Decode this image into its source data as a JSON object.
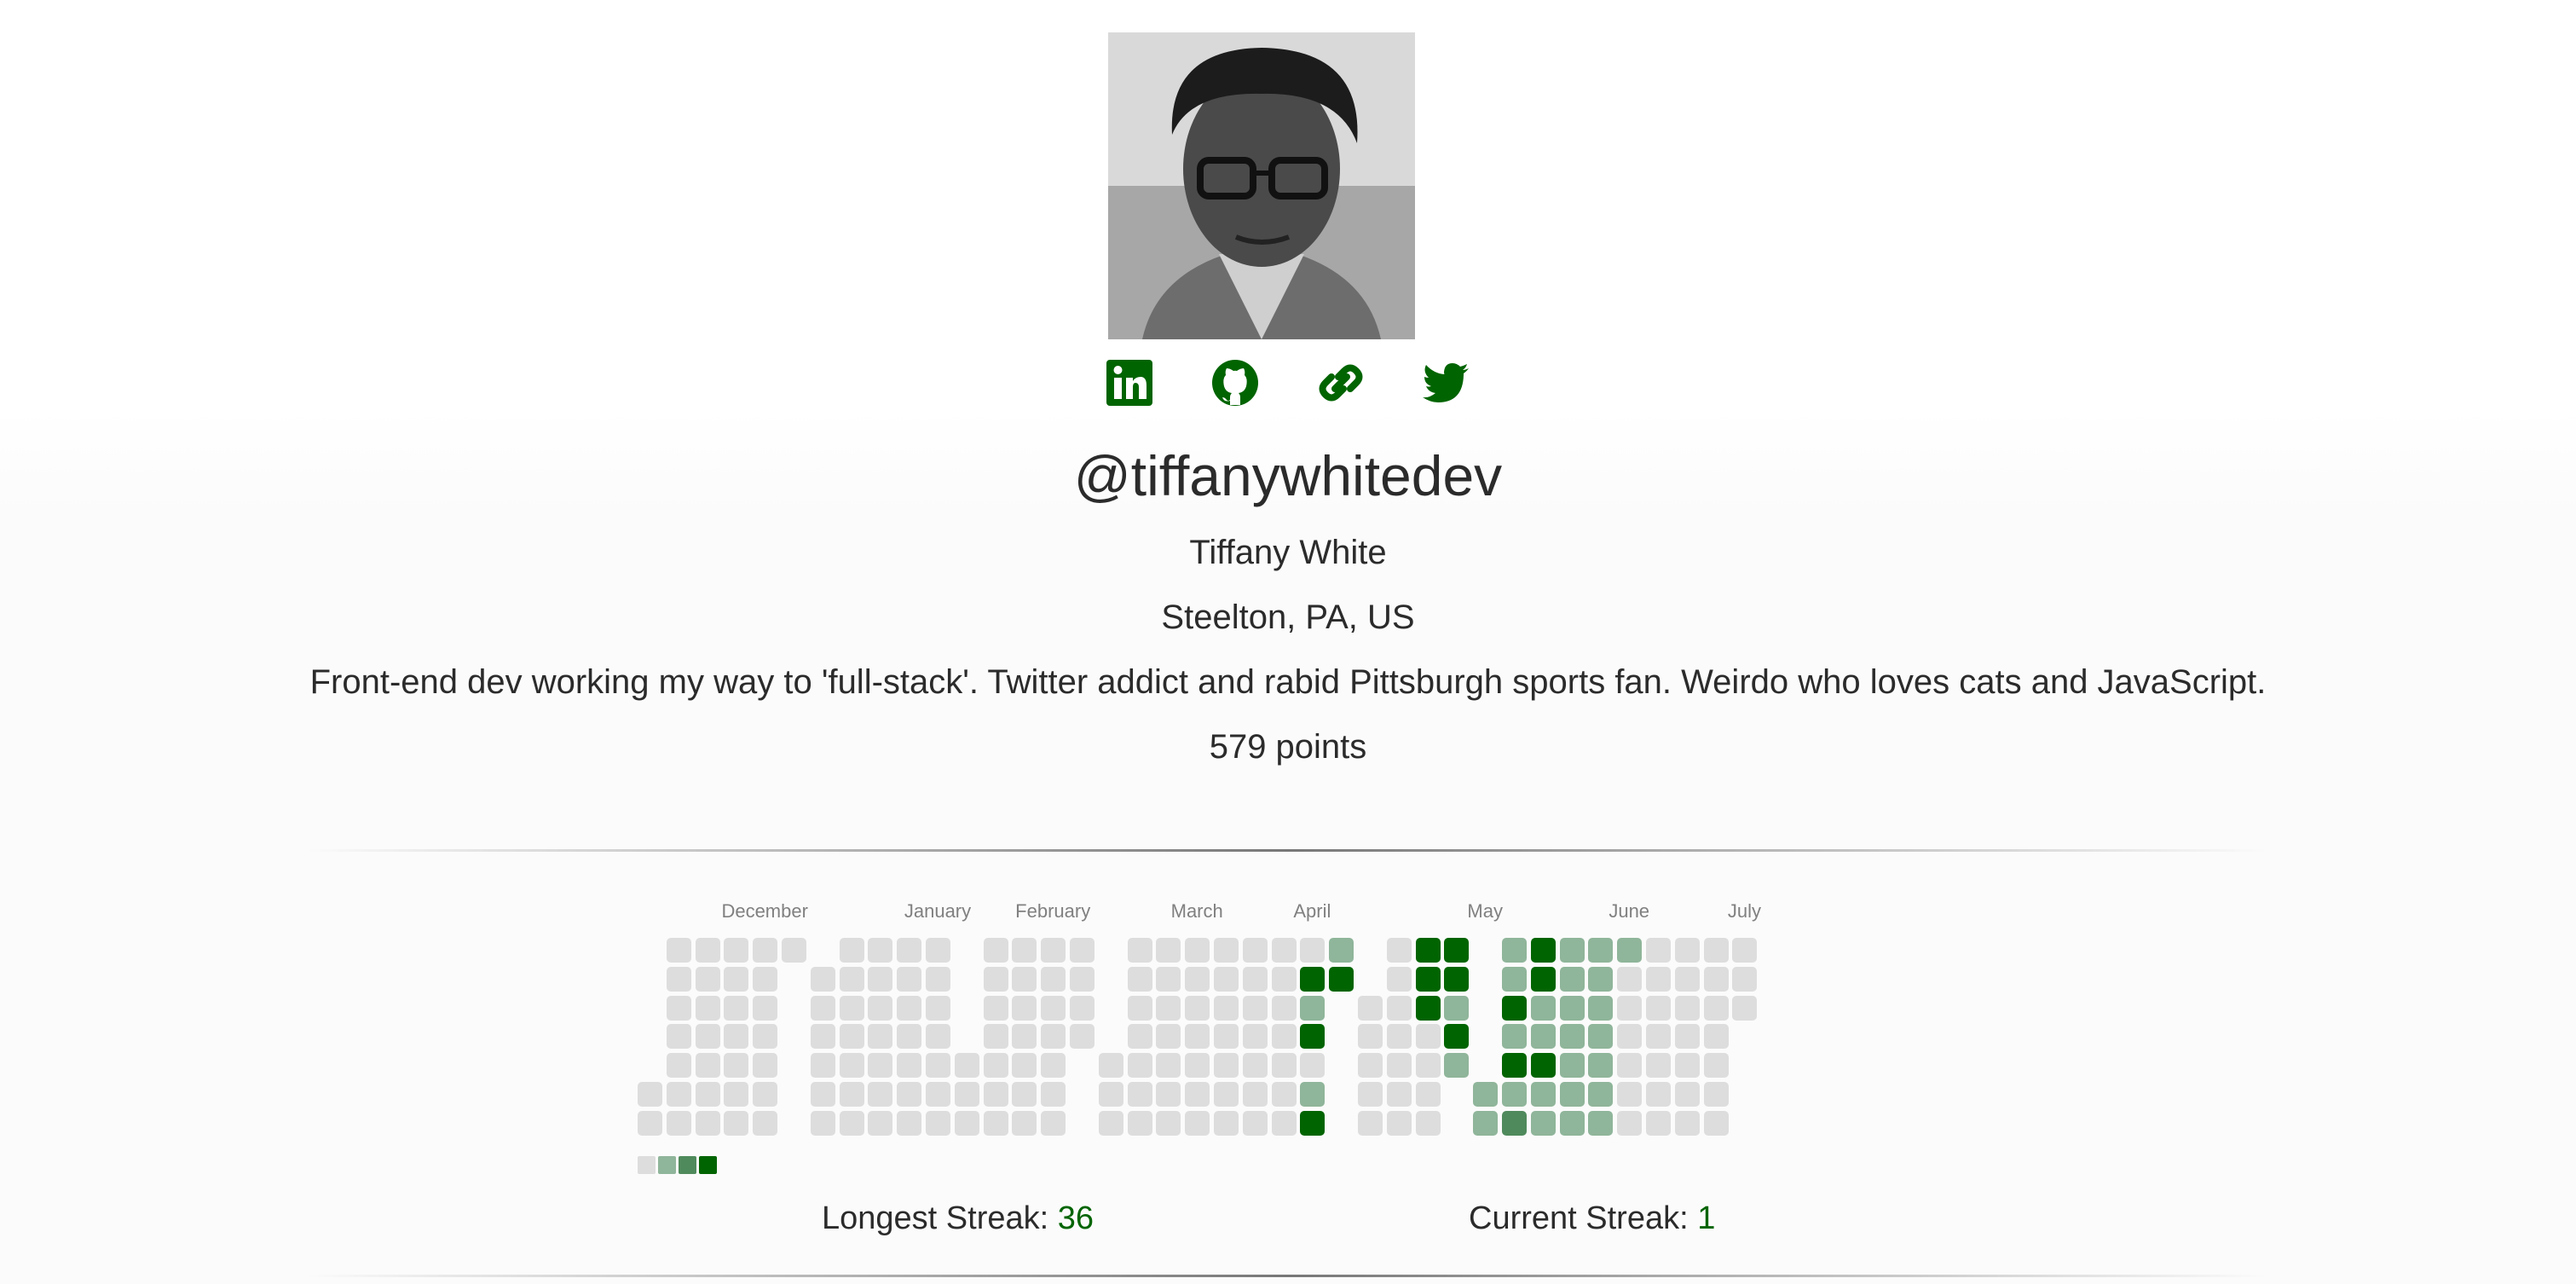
{
  "profile": {
    "handle": "@tiffanywhitedev",
    "name": "Tiffany White",
    "location": "Steelton, PA, US",
    "bio": "Front-end dev working my way to 'full-stack'. Twitter addict and rabid Pittsburgh sports fan. Weirdo who loves cats and JavaScript.",
    "points": "579 points"
  },
  "social_links": [
    {
      "name": "linkedin-icon"
    },
    {
      "name": "github-icon"
    },
    {
      "name": "website-link-icon"
    },
    {
      "name": "twitter-icon"
    }
  ],
  "colors": {
    "accent": "#006400",
    "level0": "#dddddd",
    "level1": "#8fb59a",
    "level2": "#4f8a5c",
    "level3": "#006400"
  },
  "activity": {
    "months": [
      "December",
      "January",
      "February",
      "March",
      "April",
      "May",
      "June",
      "July"
    ],
    "legend_levels": [
      0,
      1,
      2,
      3
    ],
    "weeks": [
      [
        null,
        null,
        null,
        null,
        null,
        0,
        0
      ],
      [
        0,
        0,
        0,
        0,
        0,
        0,
        0
      ],
      [
        0,
        0,
        0,
        0,
        0,
        0,
        0
      ],
      [
        0,
        0,
        0,
        0,
        0,
        0,
        0
      ],
      [
        0,
        0,
        0,
        0,
        0,
        0,
        0
      ],
      [
        0,
        null,
        null,
        null,
        null,
        null,
        null
      ],
      [
        null,
        0,
        0,
        0,
        0,
        0,
        0
      ],
      [
        0,
        0,
        0,
        0,
        0,
        0,
        0
      ],
      [
        0,
        0,
        0,
        0,
        0,
        0,
        0
      ],
      [
        0,
        0,
        0,
        0,
        0,
        0,
        0
      ],
      [
        0,
        0,
        0,
        0,
        0,
        0,
        0
      ],
      [
        null,
        null,
        null,
        null,
        0,
        0,
        0
      ],
      [
        0,
        0,
        0,
        0,
        0,
        0,
        0
      ],
      [
        0,
        0,
        0,
        0,
        0,
        0,
        0
      ],
      [
        0,
        0,
        0,
        0,
        0,
        0,
        0
      ],
      [
        0,
        0,
        0,
        0,
        null,
        null,
        null
      ],
      [
        null,
        null,
        null,
        null,
        0,
        0,
        0
      ],
      [
        0,
        0,
        0,
        0,
        0,
        0,
        0
      ],
      [
        0,
        0,
        0,
        0,
        0,
        0,
        0
      ],
      [
        0,
        0,
        0,
        0,
        0,
        0,
        0
      ],
      [
        0,
        0,
        0,
        0,
        0,
        0,
        0
      ],
      [
        0,
        0,
        0,
        0,
        0,
        0,
        0
      ],
      [
        0,
        0,
        0,
        0,
        0,
        0,
        0
      ],
      [
        0,
        3,
        1,
        3,
        0,
        1,
        3
      ],
      [
        1,
        3,
        null,
        null,
        null,
        null,
        null
      ],
      [
        null,
        null,
        0,
        0,
        0,
        0,
        0
      ],
      [
        0,
        0,
        0,
        0,
        0,
        0,
        0
      ],
      [
        3,
        3,
        3,
        0,
        0,
        0,
        0
      ],
      [
        3,
        3,
        1,
        3,
        1,
        null,
        null
      ],
      [
        null,
        null,
        null,
        null,
        null,
        1,
        1
      ],
      [
        1,
        1,
        3,
        1,
        3,
        1,
        2
      ],
      [
        3,
        3,
        1,
        1,
        3,
        1,
        1
      ],
      [
        1,
        1,
        1,
        1,
        1,
        1,
        1
      ],
      [
        1,
        1,
        1,
        1,
        1,
        1,
        1
      ],
      [
        1,
        0,
        0,
        0,
        0,
        0,
        0
      ],
      [
        0,
        0,
        0,
        0,
        0,
        0,
        0
      ],
      [
        0,
        0,
        0,
        0,
        0,
        0,
        0
      ],
      [
        0,
        0,
        0,
        0,
        0,
        0,
        0
      ],
      [
        0,
        0,
        0,
        null,
        null,
        null,
        null
      ]
    ]
  },
  "streaks": {
    "longest_label": "Longest Streak:",
    "longest_value": "36",
    "current_label": "Current Streak:",
    "current_value": "1"
  }
}
